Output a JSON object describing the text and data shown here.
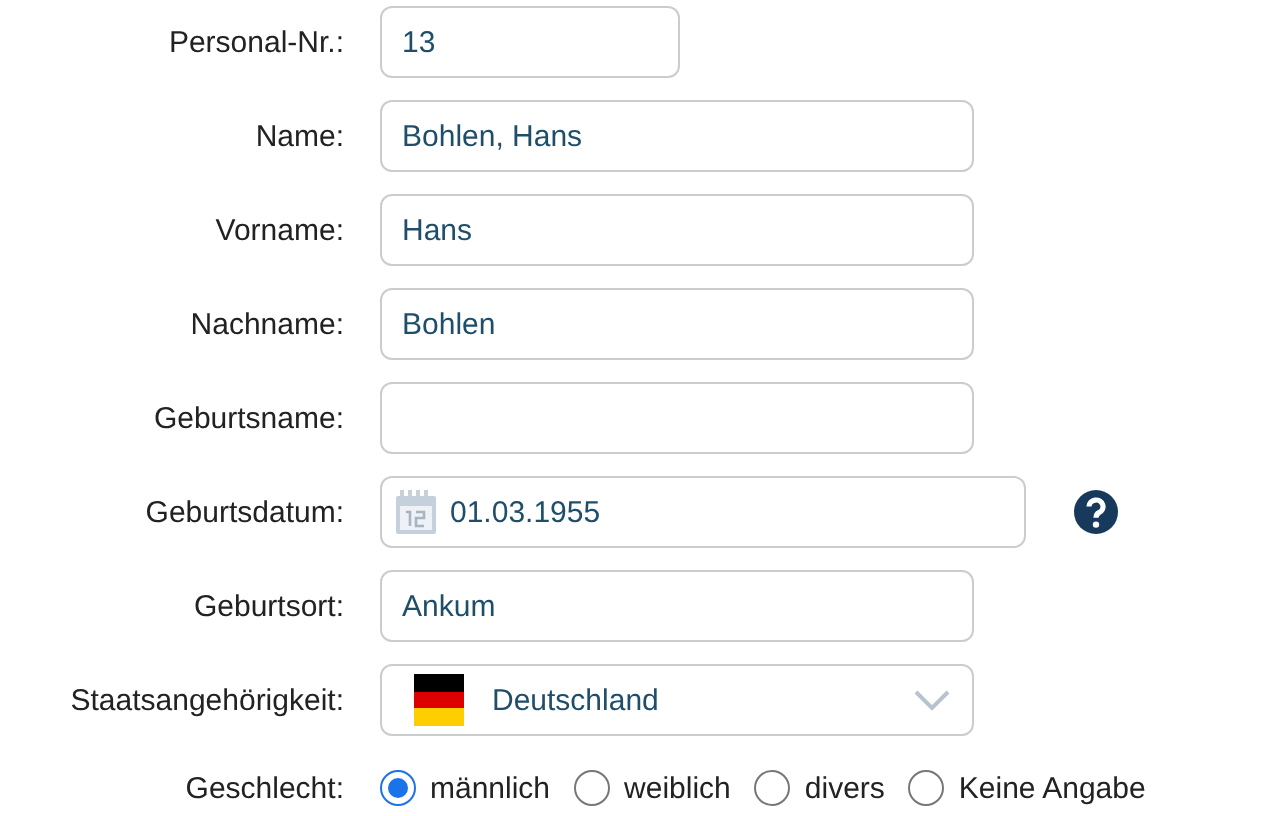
{
  "fields": [
    {
      "label": "Personal-Nr.:",
      "kind": "number",
      "value": "13"
    },
    {
      "label": "Name:",
      "kind": "text",
      "value": "Bohlen, Hans"
    },
    {
      "label": "Vorname:",
      "kind": "text",
      "value": "Hans"
    },
    {
      "label": "Nachname:",
      "kind": "text",
      "value": "Bohlen"
    },
    {
      "label": "Geburtsname:",
      "kind": "text"
    },
    {
      "label": "Geburtsdatum:",
      "kind": "date",
      "value": "01.03.1955",
      "help": true
    },
    {
      "label": "Geburtsort:",
      "kind": "text",
      "value": "Ankum"
    },
    {
      "label": "Staatsangehörigkeit:",
      "kind": "country",
      "value": "Deutschland"
    }
  ],
  "gender": {
    "label": "Geschlecht:",
    "options": [
      {
        "label": "männlich",
        "selected": true
      },
      {
        "label": "weiblich",
        "selected": false
      },
      {
        "label": "divers",
        "selected": false
      },
      {
        "label": "Keine Angabe",
        "selected": false
      }
    ]
  }
}
